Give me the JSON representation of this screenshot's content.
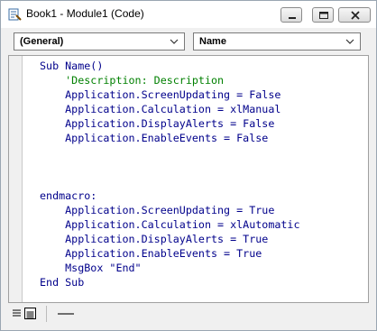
{
  "window": {
    "title": "Book1 - Module1 (Code)"
  },
  "toolbar": {
    "object_combo": "(General)",
    "procedure_combo": "Name"
  },
  "code": {
    "lines": [
      {
        "text": "Sub Name()",
        "comment": false
      },
      {
        "text": "    'Description: Description",
        "comment": true
      },
      {
        "text": "    Application.ScreenUpdating = False",
        "comment": false
      },
      {
        "text": "    Application.Calculation = xlManual",
        "comment": false
      },
      {
        "text": "    Application.DisplayAlerts = False",
        "comment": false
      },
      {
        "text": "    Application.EnableEvents = False",
        "comment": false
      },
      {
        "text": "",
        "comment": false
      },
      {
        "text": "",
        "comment": false
      },
      {
        "text": "",
        "comment": false
      },
      {
        "text": "endmacro:",
        "comment": false
      },
      {
        "text": "    Application.ScreenUpdating = True",
        "comment": false
      },
      {
        "text": "    Application.Calculation = xlAutomatic",
        "comment": false
      },
      {
        "text": "    Application.DisplayAlerts = True",
        "comment": false
      },
      {
        "text": "    Application.EnableEvents = True",
        "comment": false
      },
      {
        "text": "    MsgBox \"End\"",
        "comment": false
      },
      {
        "text": "End Sub",
        "comment": false
      }
    ]
  },
  "colors": {
    "code_text": "#00008b",
    "comment_text": "#008000",
    "editor_bg": "#ffffff"
  },
  "icons": [
    "vba-module-icon",
    "minimize-icon",
    "maximize-icon",
    "close-icon",
    "chevron-down-icon",
    "procedure-view-icon",
    "full-module-view-icon"
  ]
}
